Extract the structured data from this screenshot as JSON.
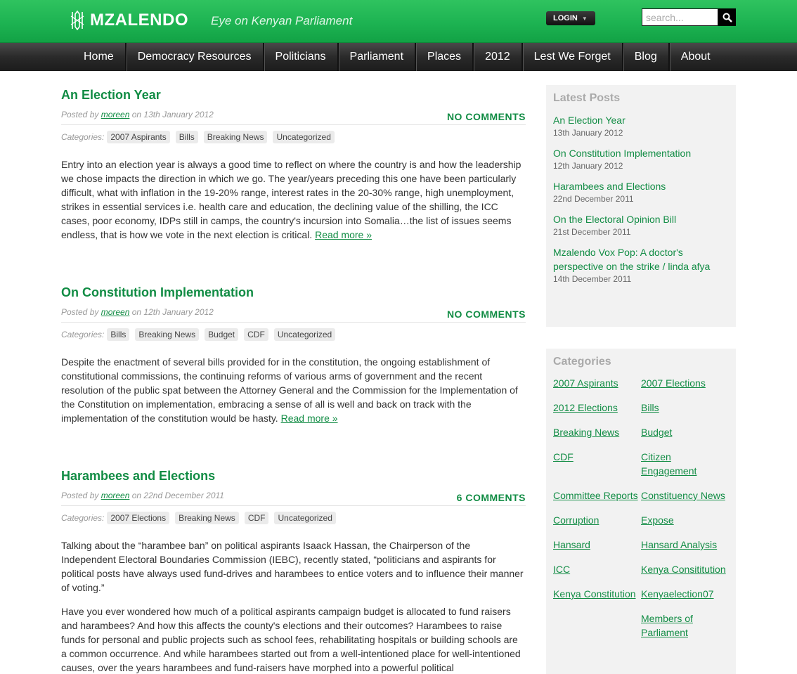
{
  "header": {
    "logo_text": "MZALENDO",
    "tagline": "Eye on Kenyan Parliament",
    "login_label": "LOGIN",
    "search_placeholder": "search..."
  },
  "nav": {
    "items": [
      "Home",
      "Democracy Resources",
      "Politicians",
      "Parliament",
      "Places",
      "2012",
      "Lest We Forget",
      "Blog",
      "About"
    ]
  },
  "posts": [
    {
      "title": "An Election Year",
      "posted_by_prefix": "Posted by",
      "author": "moreen",
      "date_text": "on 13th January 2012",
      "comments": "NO COMMENTS",
      "categories_label": "Categories:",
      "categories": [
        "2007 Aspirants",
        "Bills",
        "Breaking News",
        "Uncategorized"
      ],
      "paragraphs": [
        "Entry into an election year is always a good time to reflect on where the country is and how the leadership we chose impacts the direction in which we go. The year/years preceding this one have been particularly difficult, what with inflation in the 19-20% range, interest rates in the 20-30% range, high unemployment, strikes in essential services i.e. health care and education, the declining value of the shilling, the ICC cases, poor economy, IDPs still in camps, the country's incursion into Somalia…the list of issues seems endless, that is how we vote in the next election is critical."
      ],
      "read_more": "Read more »"
    },
    {
      "title": "On Constitution Implementation",
      "posted_by_prefix": "Posted by",
      "author": "moreen",
      "date_text": "on 12th January 2012",
      "comments": "NO COMMENTS",
      "categories_label": "Categories:",
      "categories": [
        "Bills",
        "Breaking News",
        "Budget",
        "CDF",
        "Uncategorized"
      ],
      "paragraphs": [
        "Despite the enactment of several bills provided for in the constitution, the ongoing establishment of constitutional commissions, the continuing reforms of various arms of government and the recent resolution of the public spat between the Attorney General and the Commission for the Implementation of the Constitution on implementation, embracing a sense of all is well and back on track with the implementation of the constitution would be hasty."
      ],
      "read_more": "Read more »"
    },
    {
      "title": "Harambees and Elections",
      "posted_by_prefix": "Posted by",
      "author": "moreen",
      "date_text": "on 22nd December 2011",
      "comments": "6 COMMENTS",
      "categories_label": "Categories:",
      "categories": [
        "2007 Elections",
        "Breaking News",
        "CDF",
        "Uncategorized"
      ],
      "paragraphs": [
        "Talking about the “harambee ban” on political aspirants Isaack Hassan, the Chairperson of the Independent Electoral Boundaries Commission (IEBC), recently stated, “politicians and aspirants for political posts have always used fund-drives and harambees to entice voters and to influence their manner of voting.”",
        "Have you ever wondered how much of a political aspirants campaign budget is allocated to fund raisers and harambees? And how this affects the county's elections and their outcomes? Harambees to raise funds for personal and public projects such as school fees, rehabilitating hospitals or building schools are a common occurrence. And while harambees started out from a well-intentioned place for well-intentioned causes, over the years harambees and fund-raisers have morphed into a powerful political"
      ],
      "read_more": ""
    }
  ],
  "sidebar": {
    "latest_title": "Latest Posts",
    "latest": [
      {
        "title": "An Election Year",
        "date": "13th January 2012"
      },
      {
        "title": "On Constitution Implementation",
        "date": "12th January 2012"
      },
      {
        "title": "Harambees and Elections",
        "date": "22nd December 2011"
      },
      {
        "title": "On the Electoral Opinion Bill",
        "date": "21st December 2011"
      },
      {
        "title": "Mzalendo Vox Pop: A doctor's perspective on the strike / linda afya",
        "date": "14th December 2011"
      }
    ],
    "categories_title": "Categories",
    "categories": [
      "2007 Aspirants",
      "2007 Elections",
      "2012 Elections",
      "Bills",
      "Breaking News",
      "Budget",
      "CDF",
      "Citizen Engagement",
      "Committee Reports",
      "Constituency News",
      "Corruption",
      "Expose",
      "Hansard",
      "Hansard Analysis",
      "ICC",
      "Kenya Consititution",
      "Kenya Constitution",
      "Kenyaelection07",
      "",
      "Members of Parliament"
    ]
  },
  "colors": {
    "brand_green": "#118c44",
    "header_green": "#1db352",
    "nav_dark": "#2a2a2a"
  }
}
